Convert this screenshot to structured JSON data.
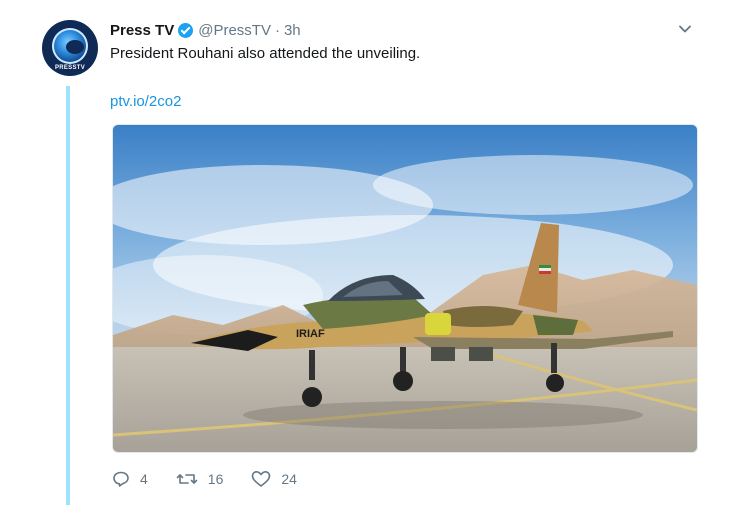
{
  "tweet": {
    "display_name": "Press TV",
    "handle": "@PressTV",
    "separator": "·",
    "time": "3h",
    "text": "President Rouhani also attended the unveiling.",
    "link": "ptv.io/2co2",
    "avatar_brand": "PRESSTV",
    "media": {
      "description_icon": "fighter-jet-photo",
      "jet_marking": "IRIAF"
    },
    "actions": {
      "reply_count": "4",
      "retweet_count": "16",
      "like_count": "24"
    }
  },
  "colors": {
    "thread_line": "#9fe2fb",
    "link": "#1b95e0",
    "verified": "#1da1f2",
    "muted": "#657786"
  }
}
